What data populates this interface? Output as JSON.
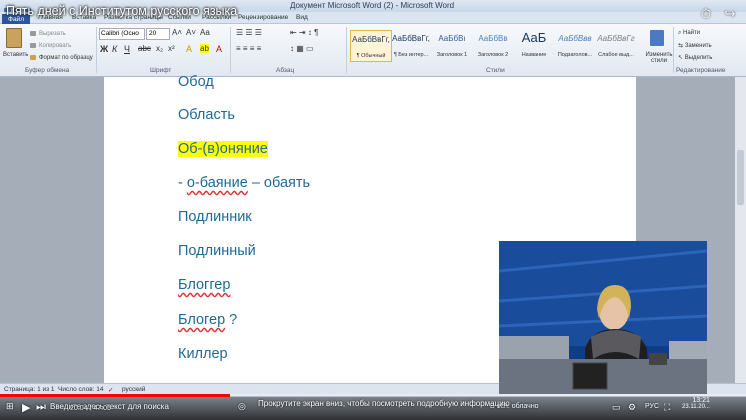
{
  "window": {
    "title": "Документ Microsoft Word (2) - Microsoft Word"
  },
  "video": {
    "title": "Пять дней с Институтом русского языка",
    "hint": "Прокрутите экран вниз, чтобы посмотреть подробную информацию",
    "bottom_left": "Введите здесь текст для поиска",
    "bottom_time_code": "20:04 / 47:05"
  },
  "tabs": {
    "file": "Файл",
    "home": "Главная",
    "insert": "Вставка",
    "layout": "Разметка страницы",
    "refs": "Ссылки",
    "mail": "Рассылки",
    "review": "Рецензирование",
    "view": "Вид"
  },
  "ribbon": {
    "paste": "Вставить",
    "cut": "Вырезать",
    "copy": "Копировать",
    "format_painter": "Формат по образцу",
    "clipboard_label": "Буфер обмена",
    "font_name": "Calibri (Осно",
    "font_size": "20",
    "font_label": "Шрифт",
    "paragraph_label": "Абзац",
    "styles_label": "Стили",
    "editing_label": "Редактирование",
    "change_styles": "Изменить стили",
    "find": "Найти",
    "replace": "Заменить",
    "select": "Выделить",
    "styles": [
      {
        "preview": "АаБбВвГг,",
        "name": "¶ Обычный"
      },
      {
        "preview": "АаБбВвГг,",
        "name": "¶ Без интер..."
      },
      {
        "preview": "АаБбВı",
        "name": "Заголовок 1"
      },
      {
        "preview": "АаБбВв",
        "name": "Заголовок 2"
      },
      {
        "preview": "АаБ",
        "name": "Название"
      },
      {
        "preview": "АаБбВвв",
        "name": "Подзаголов..."
      },
      {
        "preview": "АаБбВвГг",
        "name": "Слабое выд..."
      }
    ]
  },
  "document": {
    "lines": [
      "Обод",
      "Область",
      "Об-(в)оняние",
      "- о-баяние – обаять",
      "Подлинник",
      "Подлинный",
      "Блоггер",
      "Блогер ?",
      "Киллер"
    ]
  },
  "status": {
    "page": "Страница: 1 из 1",
    "words": "Число слов: 14",
    "lang": "русский"
  },
  "taskbar": {
    "weather": "В осн. облачно",
    "lang": "РУС",
    "time": "13:21",
    "date": "23.11.20..."
  }
}
